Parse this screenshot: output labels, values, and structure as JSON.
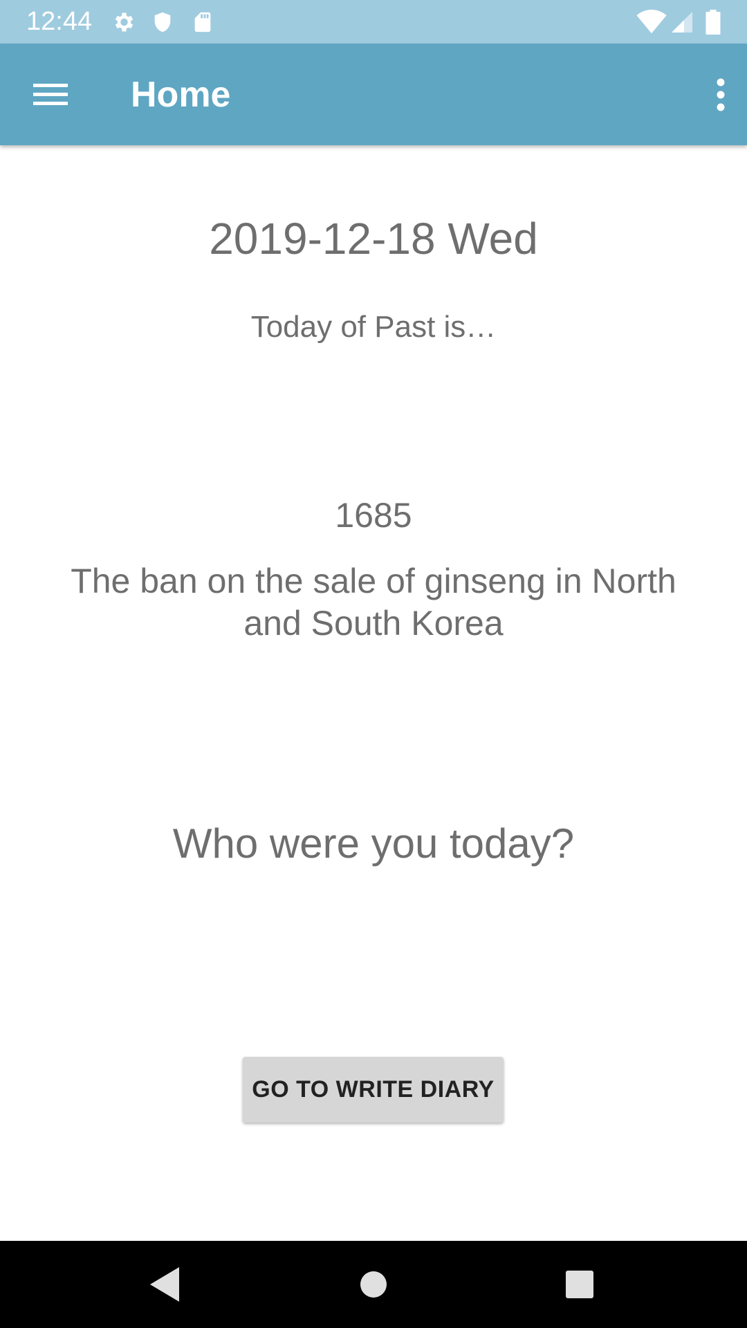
{
  "status_bar": {
    "time": "12:44",
    "left_icons": [
      "settings-icon",
      "shield-icon",
      "sd-card-icon"
    ],
    "right_icons": [
      "wifi-icon",
      "cellular-signal-icon",
      "battery-icon"
    ],
    "background": "#9fcbdf"
  },
  "app_bar": {
    "title": "Home",
    "menu_icon": "hamburger-menu-icon",
    "overflow_icon": "more-vert-icon",
    "background": "#5fa6c2"
  },
  "main": {
    "date": "2019-12-18 Wed",
    "subtitle": "Today of Past is…",
    "event_year": "1685",
    "event_description": "The ban on the sale of ginseng in North and South Korea",
    "question": "Who were you today?",
    "diary_button_label": "GO TO WRITE DIARY"
  },
  "nav_bar": {
    "buttons": [
      "back-icon",
      "home-icon",
      "recents-icon"
    ]
  }
}
